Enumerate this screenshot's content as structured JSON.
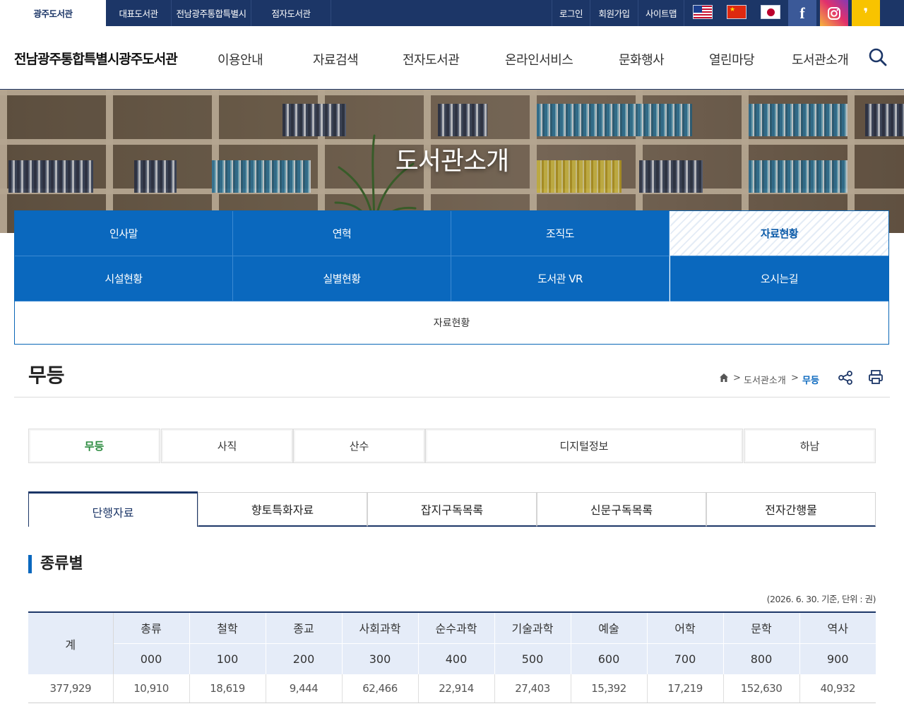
{
  "top_bar": {
    "site_tabs": [
      "광주도서관",
      "대표도서관",
      "전남광주통합특별시",
      "점자도서관"
    ],
    "utility": [
      "로그인",
      "회원가입",
      "사이트맵"
    ],
    "sns": {
      "facebook": "f",
      "kakao": "❜"
    }
  },
  "header": {
    "logo": "전남광주통합특별시광주도서관",
    "nav": [
      "이용안내",
      "자료검색",
      "전자도서관",
      "온라인서비스",
      "문화행사",
      "열린마당",
      "도서관소개"
    ]
  },
  "hero": {
    "title": "도서관소개"
  },
  "submenu": {
    "items": [
      "인사말",
      "연혁",
      "조직도",
      "자료현황",
      "시설현황",
      "실별현황",
      "도서관 VR",
      "오시는길"
    ],
    "active": "자료현황",
    "sub_label": "자료현황"
  },
  "page": {
    "title": "무등",
    "breadcrumb": [
      ">",
      "도서관소개",
      ">",
      "무등"
    ]
  },
  "branch_tabs": [
    "무등",
    "사직",
    "산수",
    "디지털정보",
    "하남"
  ],
  "type_tabs": [
    "단행자료",
    "향토특화자료",
    "잡지구독목록",
    "신문구독목록",
    "전자간행물"
  ],
  "section": {
    "title": "종류별",
    "note": "(2026. 6. 30. 기준, 단위 : 권)"
  },
  "table": {
    "total_label": "계",
    "categories": [
      "총류",
      "철학",
      "종교",
      "사회과학",
      "순수과학",
      "기술과학",
      "예술",
      "어학",
      "문학",
      "역사"
    ],
    "codes": [
      "000",
      "100",
      "200",
      "300",
      "400",
      "500",
      "600",
      "700",
      "800",
      "900"
    ],
    "total": "377,929",
    "values": [
      "10,910",
      "18,619",
      "9,444",
      "62,466",
      "22,914",
      "27,403",
      "15,392",
      "17,219",
      "152,630",
      "40,932"
    ]
  },
  "colors": {
    "navy": "#1c3667",
    "accent_blue": "#0a68be",
    "active_green": "#2a8a3e",
    "table_header": "#e5ecf8"
  }
}
